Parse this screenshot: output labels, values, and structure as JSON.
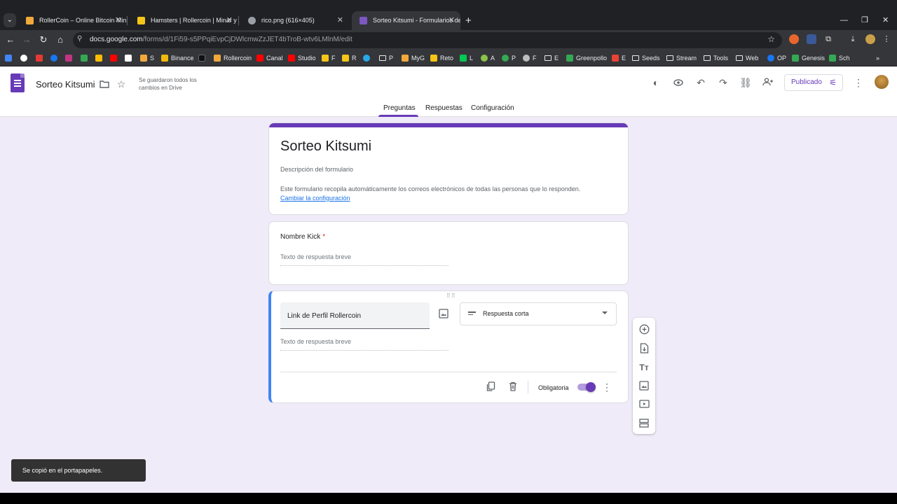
{
  "browser": {
    "tabs": [
      {
        "title": "RollerCoin – Online Bitcoin Mining",
        "favicon_color": "#f2a93b",
        "active": false
      },
      {
        "title": "Hamsters | Rollercoin | Minar y g",
        "favicon_color": "#f5c518",
        "active": false
      },
      {
        "title": "rico.png (616×405)",
        "favicon_color": "#9aa0a6",
        "active": false
      },
      {
        "title": "Sorteo Kitsumi - Formularios de",
        "favicon_color": "#7e57c2",
        "active": true
      }
    ],
    "url_domain": "docs.google.com",
    "url_path": "/forms/d/1Fi59-s5PPqiEvpCjDWlcmwZzJET4bTroB-wtv6LMlnM/edit",
    "bookmarks": [
      {
        "label": "S",
        "color": "#f2a93b"
      },
      {
        "label": "Binance",
        "color": "#f0b90b"
      },
      {
        "label": "Rollercoin",
        "color": "#f2a93b"
      },
      {
        "label": "Canal",
        "color": "#ff0000"
      },
      {
        "label": "Studio",
        "color": "#ff0000"
      },
      {
        "label": "F",
        "color": "#f5c518"
      },
      {
        "label": "R",
        "color": "#f5c518"
      },
      {
        "label": "P",
        "color": "folder"
      },
      {
        "label": "MyG",
        "color": "#f2a93b"
      },
      {
        "label": "Reto",
        "color": "#f5c518"
      },
      {
        "label": "L",
        "color": "#00c853"
      },
      {
        "label": "A",
        "color": "#8bc34a"
      },
      {
        "label": "P",
        "color": "#34a853"
      },
      {
        "label": "F",
        "color": "#bdbdbd"
      },
      {
        "label": "E",
        "color": "folder"
      },
      {
        "label": "Greenpollo",
        "color": "#34a853"
      },
      {
        "label": "E",
        "color": "#ea4335"
      },
      {
        "label": "Seeds",
        "color": "folder"
      },
      {
        "label": "Stream",
        "color": "folder"
      },
      {
        "label": "Tools",
        "color": "folder"
      },
      {
        "label": "Web",
        "color": "folder"
      },
      {
        "label": "OP",
        "color": "#1877f2"
      },
      {
        "label": "Genesis",
        "color": "#34a853"
      },
      {
        "label": "Sch",
        "color": "#34a853"
      }
    ]
  },
  "appbar": {
    "doc_title": "Sorteo Kitsumi",
    "saved_status": "Se guardaron todos los cambios en Drive",
    "publish_label": "Publicado"
  },
  "tabs": {
    "questions": "Preguntas",
    "responses": "Respuestas",
    "settings": "Configuración"
  },
  "form": {
    "title": "Sorteo Kitsumi",
    "description_placeholder": "Descripción del formulario",
    "email_note": "Este formulario recopila automáticamente los correos electrónicos de todas las personas que lo responden.",
    "email_note_link": "Cambiar la configuración"
  },
  "questions": [
    {
      "title": "Nombre Kick",
      "required_mark": "*",
      "answer_placeholder": "Texto de respuesta breve"
    },
    {
      "title": "Link de Perfil Rollercoin",
      "type": "Respuesta corta",
      "answer_placeholder": "Texto de respuesta breve",
      "required_label": "Obligatoria",
      "required": true
    }
  ],
  "snackbar": "Se copió en el portapapeles.",
  "colors": {
    "accent": "#673ab7",
    "active_card_border": "#4285f4",
    "background": "#f0ebf8"
  }
}
